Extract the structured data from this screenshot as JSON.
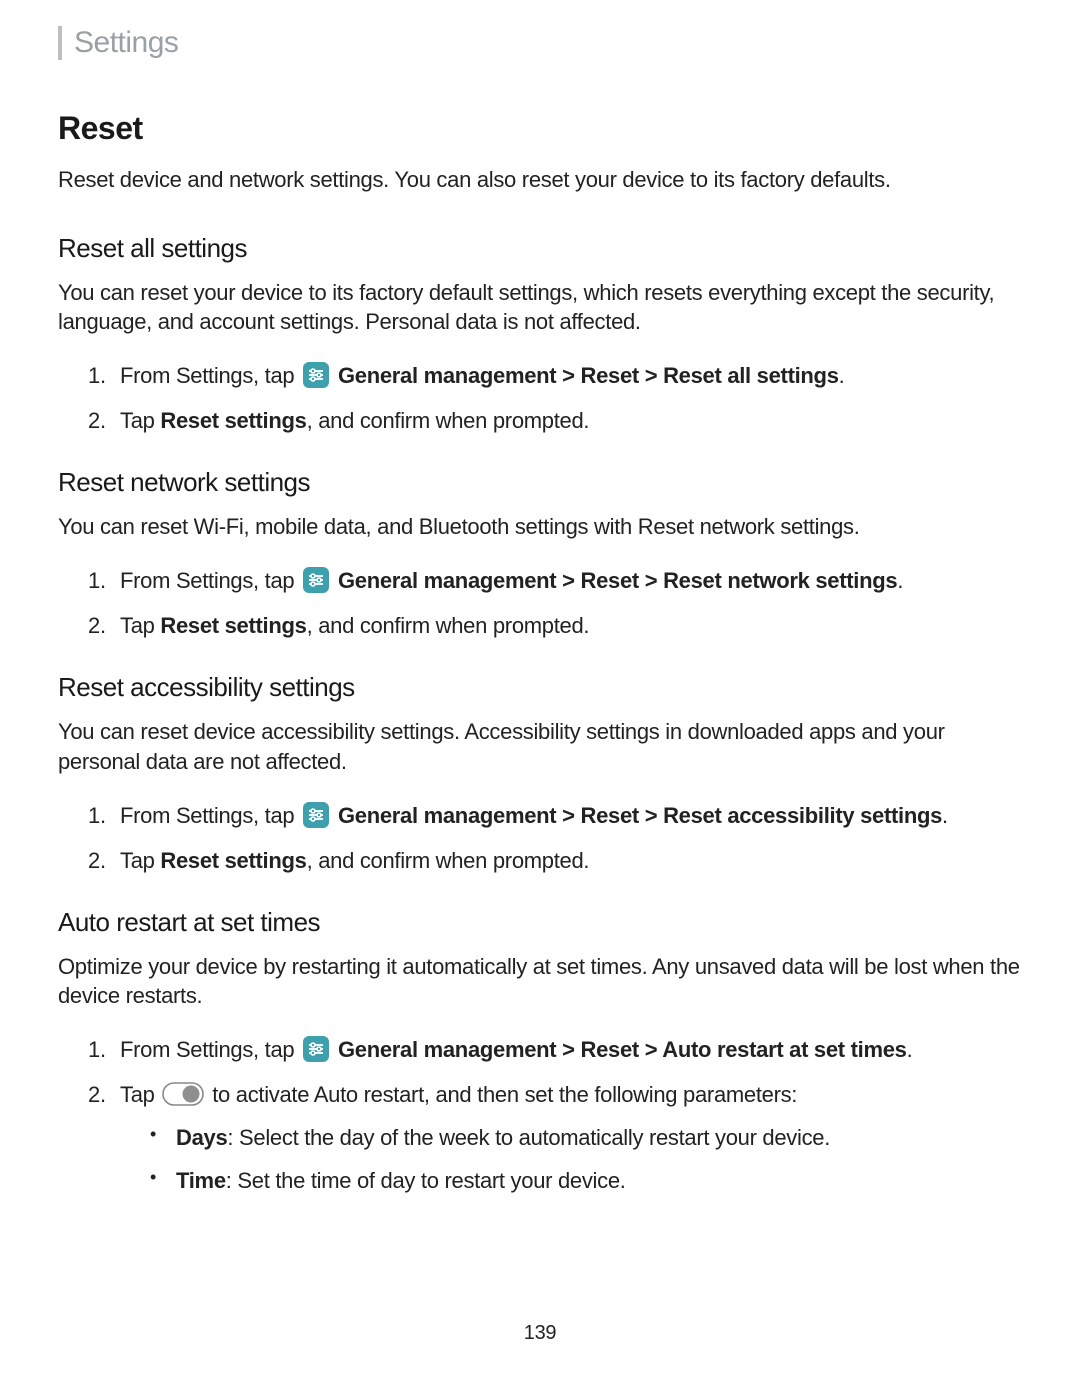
{
  "header": {
    "tab": "Settings"
  },
  "title": "Reset",
  "intro": "Reset device and network settings. You can also reset your device to its factory defaults.",
  "sections": {
    "reset_all": {
      "heading": "Reset all settings",
      "desc": "You can reset your device to its factory default settings, which resets everything except the security, language, and account settings. Personal data is not affected.",
      "step1_pre": "From Settings, tap ",
      "step1_path": " General management > Reset > Reset all settings",
      "step1_post": ".",
      "step2_pre": "Tap ",
      "step2_bold": "Reset settings",
      "step2_post": ", and confirm when prompted."
    },
    "reset_network": {
      "heading": "Reset network settings",
      "desc": "You can reset Wi-Fi, mobile data, and Bluetooth settings with Reset network settings.",
      "step1_pre": "From Settings, tap ",
      "step1_path": " General management > Reset > Reset network settings",
      "step1_post": ".",
      "step2_pre": "Tap ",
      "step2_bold": "Reset settings",
      "step2_post": ", and confirm when prompted."
    },
    "reset_accessibility": {
      "heading": "Reset accessibility settings",
      "desc": "You can reset device accessibility settings. Accessibility settings in downloaded apps and your personal data are not affected.",
      "step1_pre": "From Settings, tap ",
      "step1_path": " General management > Reset > Reset accessibility settings",
      "step1_post": ".",
      "step2_pre": "Tap ",
      "step2_bold": "Reset settings",
      "step2_post": ", and confirm when prompted."
    },
    "auto_restart": {
      "heading": "Auto restart at set times",
      "desc": "Optimize your device by restarting it automatically at set times. Any unsaved data will be lost when the device restarts.",
      "step1_pre": "From Settings, tap ",
      "step1_path": " General management > Reset > Auto restart at set times",
      "step1_post": ".",
      "step2_pre": "Tap ",
      "step2_post": " to activate Auto restart, and then set the following parameters:",
      "bullets": {
        "days_label": "Days",
        "days_text": ": Select the day of the week to automatically restart your device.",
        "time_label": "Time",
        "time_text": ": Set the time of day to restart your device."
      }
    }
  },
  "page_number": "139"
}
